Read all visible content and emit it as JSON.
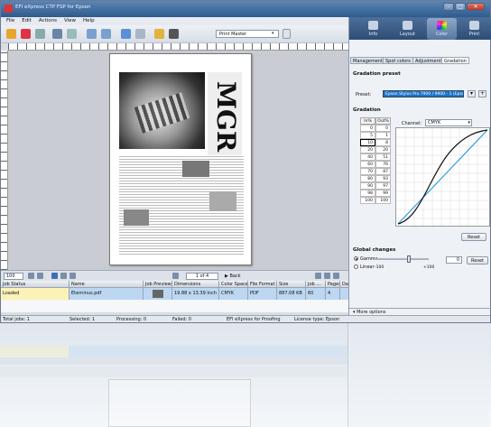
{
  "window": {
    "title": "EFI eXpress CTP FSP for Epson"
  },
  "menu": [
    "File",
    "Edit",
    "Actions",
    "View",
    "Help"
  ],
  "toolbar": {
    "printer": "Print Master"
  },
  "viewer": {
    "zoom": "100",
    "page": "1 of 4",
    "back": "Back",
    "magazine_word": "MGR"
  },
  "jobs": {
    "headers": [
      "Job Status",
      "Name",
      "Job Preview",
      "Dimensions",
      "Color Space",
      "File Format",
      "Size",
      "Job ...",
      "Pages",
      "Dat"
    ],
    "rows": [
      {
        "status": "Loaded",
        "name": "Eterninus.pdf",
        "preview": "",
        "dimensions": "19.88 x 13.39 Inch",
        "color_space": "CMYK",
        "format": "PDF",
        "size": "887.08 KB",
        "job": "60",
        "pages": "4",
        "date": ""
      }
    ]
  },
  "summary": {
    "total": "Total jobs: 1",
    "selected": "Selected: 1",
    "processing": "Processing: 0",
    "failed": "Failed: 0",
    "product": "EFI eXpress for Proofing",
    "license": "License type: Epson"
  },
  "right_tools": [
    "Info",
    "Layout",
    "Color",
    "Print"
  ],
  "right_tabs": [
    "Management",
    "Spot colors",
    "Adjustment",
    "Gradation"
  ],
  "gradation": {
    "preset_title": "Gradation preset",
    "preset_label": "Preset:",
    "preset_value": "Epson Stylus Pro 7900 / 9900 - 1 (Epson)",
    "section_title": "Gradation",
    "col_in": "In%",
    "col_out": "Out%",
    "rows": [
      [
        "0",
        "0"
      ],
      [
        "5",
        "1"
      ],
      [
        "10",
        "8"
      ],
      [
        "20",
        "20"
      ],
      [
        "40",
        "51"
      ],
      [
        "60",
        "76"
      ],
      [
        "70",
        "87"
      ],
      [
        "80",
        "93"
      ],
      [
        "90",
        "97"
      ],
      [
        "98",
        "99"
      ],
      [
        "100",
        "100"
      ]
    ],
    "channel_label": "Channel:",
    "channel_value": "CMYK",
    "reset": "Reset"
  },
  "global": {
    "title": "Global changes",
    "gamma": "Gamma",
    "linear": "Linear",
    "value": "0",
    "min": "-100",
    "max": "+100",
    "reset": "Reset"
  },
  "more_options": "More options",
  "colors": {
    "accent": "#1d74c9",
    "titlebar": "#2f5a8d",
    "job_row": "#bcd7f2"
  }
}
